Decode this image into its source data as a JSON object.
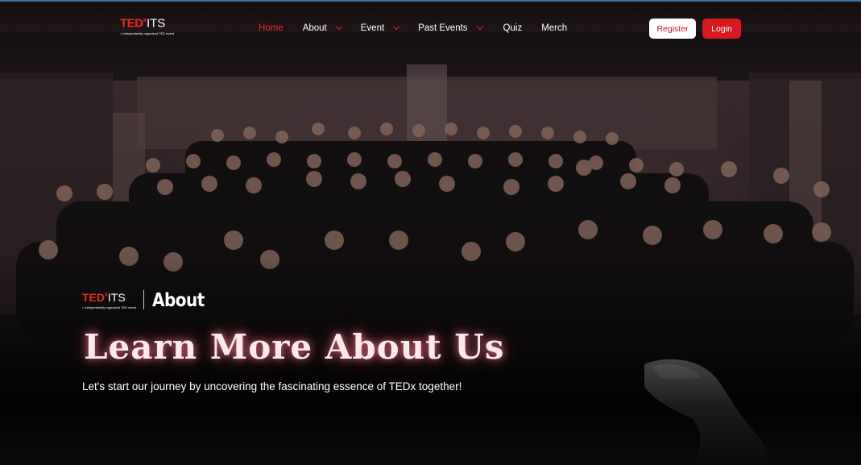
{
  "brand": {
    "name_ted": "TED",
    "name_x": "x",
    "name_its": "ITS",
    "tagline": "= independently organized TED event"
  },
  "nav": {
    "items": [
      {
        "label": "Home",
        "active": true,
        "has_dropdown": false
      },
      {
        "label": "About",
        "active": false,
        "has_dropdown": true
      },
      {
        "label": "Event",
        "active": false,
        "has_dropdown": true
      },
      {
        "label": "Past Events",
        "active": false,
        "has_dropdown": true
      },
      {
        "label": "Quiz",
        "active": false,
        "has_dropdown": false
      },
      {
        "label": "Merch",
        "active": false,
        "has_dropdown": false
      }
    ],
    "register_label": "Register",
    "login_label": "Login"
  },
  "hero": {
    "section_label": "About",
    "headline": "Learn More About Us",
    "subtitle": "Let's start our journey by uncovering the fascinating essence of TEDx together!"
  },
  "colors": {
    "accent_red": "#e62b1e",
    "login_bg": "#d71920",
    "headline_glow": "#ff8296"
  }
}
